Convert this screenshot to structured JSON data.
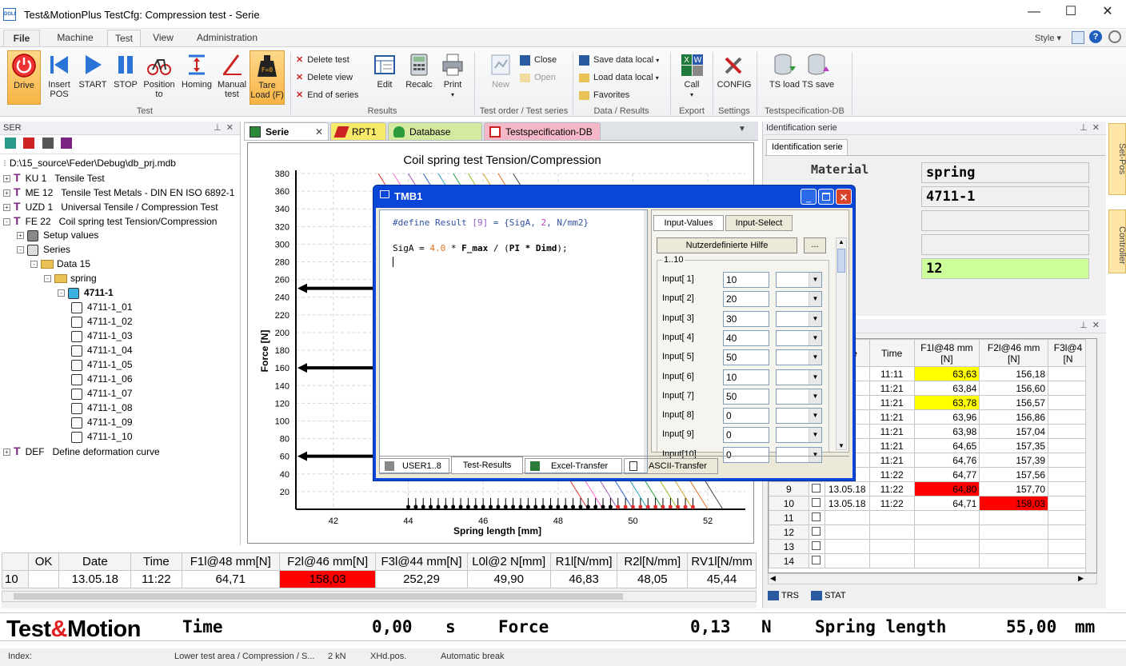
{
  "app": {
    "title": "Test&MotionPlus  TestCfg: Compression test - Serie",
    "icon_text": "DOLI"
  },
  "window_controls": {
    "minimize": "—",
    "maximize": "☐",
    "close": "✕"
  },
  "menu_tabs": [
    "File",
    "Machine",
    "Test",
    "View",
    "Administration"
  ],
  "menu_active": "Test",
  "style_label": "Style",
  "ribbon": {
    "test_buttons": [
      {
        "label": "Drive",
        "icon": "power-icon"
      },
      {
        "label": "Insert POS",
        "icon": "step-back-icon"
      },
      {
        "label": "START",
        "icon": "play-icon"
      },
      {
        "label": "STOP",
        "icon": "pause-icon"
      },
      {
        "label": "Position to",
        "icon": "bicycle-icon"
      },
      {
        "label": "Homing",
        "icon": "homing-icon"
      },
      {
        "label": "Manual test",
        "icon": "manual-test-icon"
      },
      {
        "label": "Tare Load (F)",
        "icon": "tare-weight-icon"
      }
    ],
    "test_group": "Test",
    "results_small": [
      "Delete test",
      "Delete view",
      "End of series"
    ],
    "results_buttons": [
      "Edit",
      "Recalc",
      "Print"
    ],
    "results_group": "Results",
    "order_new": "New",
    "order_small": [
      "Close",
      "Open"
    ],
    "order_group": "Test order / Test series",
    "data_small": [
      "Save data local",
      "Load data local",
      "Favorites"
    ],
    "data_group": "Data / Results",
    "export_button": "Call",
    "export_group": "Export",
    "config_button": "CONFIG",
    "settings_group": "Settings",
    "ts_buttons": [
      "TS load",
      "TS save"
    ],
    "ts_group": "Testspecification-DB"
  },
  "left_pane": {
    "header": "SER",
    "path": "D:\\15_source\\Feder\\Debug\\db_prj.mdb",
    "tree": [
      {
        "level": 0,
        "toggle": "+",
        "kind": "T",
        "code": "KU 1",
        "text": "Tensile Test"
      },
      {
        "level": 0,
        "toggle": "+",
        "kind": "T",
        "code": "ME 12",
        "text": "Tensile Test Metals - DIN EN ISO 6892-1"
      },
      {
        "level": 0,
        "toggle": "+",
        "kind": "T",
        "code": "UZD 1",
        "text": "Universal Tensile / Compression Test"
      },
      {
        "level": 0,
        "toggle": "-",
        "kind": "T",
        "code": "FE 22",
        "text": "Coil spring test Tension/Compression"
      },
      {
        "level": 1,
        "toggle": "+",
        "kind": "setup",
        "code": "",
        "text": "Setup values"
      },
      {
        "level": 1,
        "toggle": "-",
        "kind": "series",
        "code": "",
        "text": "Series"
      },
      {
        "level": 2,
        "toggle": "-",
        "kind": "folder",
        "code": "",
        "text": "Data 15"
      },
      {
        "level": 3,
        "toggle": "-",
        "kind": "folder",
        "code": "",
        "text": "spring"
      },
      {
        "level": 4,
        "toggle": "-",
        "kind": "serie",
        "code": "",
        "text": "4711-1"
      },
      {
        "level": 5,
        "toggle": "",
        "kind": "spec",
        "code": "",
        "text": "4711-1_01"
      },
      {
        "level": 5,
        "toggle": "",
        "kind": "spec",
        "code": "",
        "text": "4711-1_02"
      },
      {
        "level": 5,
        "toggle": "",
        "kind": "spec",
        "code": "",
        "text": "4711-1_03"
      },
      {
        "level": 5,
        "toggle": "",
        "kind": "spec",
        "code": "",
        "text": "4711-1_04"
      },
      {
        "level": 5,
        "toggle": "",
        "kind": "spec",
        "code": "",
        "text": "4711-1_05"
      },
      {
        "level": 5,
        "toggle": "",
        "kind": "spec",
        "code": "",
        "text": "4711-1_06"
      },
      {
        "level": 5,
        "toggle": "",
        "kind": "spec",
        "code": "",
        "text": "4711-1_07"
      },
      {
        "level": 5,
        "toggle": "",
        "kind": "spec",
        "code": "",
        "text": "4711-1_08"
      },
      {
        "level": 5,
        "toggle": "",
        "kind": "spec",
        "code": "",
        "text": "4711-1_09"
      },
      {
        "level": 5,
        "toggle": "",
        "kind": "spec",
        "code": "",
        "text": "4711-1_10"
      },
      {
        "level": 0,
        "toggle": "+",
        "kind": "T",
        "code": "DEF",
        "text": "Define deformation curve"
      }
    ]
  },
  "doc_tabs": [
    "Serie",
    "RPT1",
    "Database (FDB)",
    "Testspecification-DB"
  ],
  "chart_data": {
    "type": "line",
    "title": "Coil spring test Tension/Compression",
    "xlabel": "Spring length [mm]",
    "ylabel": "Force [N]",
    "xlim": [
      41,
      53
    ],
    "ylim": [
      0,
      380
    ],
    "x_ticks": [
      "42",
      "44",
      "46",
      "48",
      "50",
      "52"
    ],
    "y_ticks": [
      "20",
      "40",
      "60",
      "80",
      "100",
      "120",
      "140",
      "160",
      "180",
      "200",
      "220",
      "240",
      "260",
      "280",
      "300",
      "320",
      "340",
      "360",
      "380"
    ],
    "series_count": 10,
    "line_colors": [
      "#e03030",
      "#ff66cc",
      "#9b59b6",
      "#3060d0",
      "#20a0c0",
      "#20a040",
      "#90c020",
      "#d0a020",
      "#e07020",
      "#404040"
    ],
    "x_start": [
      43.2,
      43.6,
      44.0,
      44.4,
      44.8,
      45.2,
      45.6,
      46.0,
      46.4,
      46.8
    ],
    "force_arrows": [
      250,
      160,
      60
    ]
  },
  "dialog": {
    "title": "TMB1",
    "code_line1_prefix": "#define Result ",
    "code_line1_idx": "[9]",
    "code_line1_rest": " = {SigA, ",
    "code_line1_num": "2",
    "code_line1_end": ", N/mm2}",
    "code_line2_a": "SigA = ",
    "code_line2_num": "4.0",
    "code_line2_b": " * ",
    "code_line2_c": "F_max",
    "code_line2_d": " / (",
    "code_line2_e": "PI * Dimd",
    "code_line2_f": ");",
    "tabs": [
      "Input-Values",
      "Input-Select"
    ],
    "help_button": "Nutzerdefinierte Hilfe",
    "ellipsis_button": "...",
    "group_label": "1..10",
    "inputs": [
      {
        "label": "Input[ 1]",
        "value": "10"
      },
      {
        "label": "Input[ 2]",
        "value": "20"
      },
      {
        "label": "Input[ 3]",
        "value": "30"
      },
      {
        "label": "Input[ 4]",
        "value": "40"
      },
      {
        "label": "Input[ 5]",
        "value": "50"
      },
      {
        "label": "Input[ 6]",
        "value": "10"
      },
      {
        "label": "Input[ 7]",
        "value": "50"
      },
      {
        "label": "Input[ 8]",
        "value": "0"
      },
      {
        "label": "Input[ 9]",
        "value": "0"
      },
      {
        "label": "Input[10]",
        "value": "0"
      }
    ],
    "bottom_tabs": [
      "USER1..8",
      "Test-Results",
      "Excel-Transfer",
      "ASCII-Transfer"
    ]
  },
  "identification": {
    "header": "Identification serie",
    "tab": "Identification serie",
    "rows": [
      {
        "label": "Material",
        "value": "spring",
        "highlight": false
      },
      {
        "label": "ber",
        "value": "4711-1",
        "highlight": false
      },
      {
        "label": "ber",
        "value": "",
        "highlight": false
      },
      {
        "label": "ent",
        "value": "",
        "highlight": false
      },
      {
        "label": "o.",
        "value": "12",
        "highlight": true
      }
    ]
  },
  "side_tabs": [
    "Set-Pos",
    "Controller"
  ],
  "right_table": {
    "columns": [
      "",
      "",
      "Date",
      "Time",
      "F1l@48 mm\n[N]",
      "F2l@46 mm\n[N]",
      "F3l@4\n[N"
    ],
    "rows": [
      {
        "n": "",
        "date": "8",
        "time": "11:11",
        "f1": "63,63",
        "f2": "156,18",
        "f1c": "yellow",
        "f2c": ""
      },
      {
        "n": "",
        "date": "8",
        "time": "11:21",
        "f1": "63,84",
        "f2": "156,60",
        "f1c": "",
        "f2c": ""
      },
      {
        "n": "",
        "date": "8",
        "time": "11:21",
        "f1": "63,78",
        "f2": "156,57",
        "f1c": "yellow",
        "f2c": ""
      },
      {
        "n": "",
        "date": "8",
        "time": "11:21",
        "f1": "63,96",
        "f2": "156,86",
        "f1c": "",
        "f2c": ""
      },
      {
        "n": "",
        "date": "8",
        "time": "11:21",
        "f1": "63,98",
        "f2": "157,04",
        "f1c": "",
        "f2c": ""
      },
      {
        "n": "",
        "date": "8",
        "time": "11:21",
        "f1": "64,65",
        "f2": "157,35",
        "f1c": "",
        "f2c": ""
      },
      {
        "n": "",
        "date": "8",
        "time": "11:21",
        "f1": "64,76",
        "f2": "157,39",
        "f1c": "",
        "f2c": ""
      },
      {
        "n": "",
        "date": "8",
        "time": "11:22",
        "f1": "64,77",
        "f2": "157,56",
        "f1c": "",
        "f2c": ""
      },
      {
        "n": "9",
        "date": "13.05.18",
        "time": "11:22",
        "f1": "64,80",
        "f2": "157,70",
        "f1c": "red",
        "f2c": ""
      },
      {
        "n": "10",
        "date": "13.05.18",
        "time": "11:22",
        "f1": "64,71",
        "f2": "158,03",
        "f1c": "",
        "f2c": "red"
      },
      {
        "n": "11",
        "date": "",
        "time": "",
        "f1": "",
        "f2": "",
        "f1c": "",
        "f2c": ""
      },
      {
        "n": "12",
        "date": "",
        "time": "",
        "f1": "",
        "f2": "",
        "f1c": "",
        "f2c": ""
      },
      {
        "n": "13",
        "date": "",
        "time": "",
        "f1": "",
        "f2": "",
        "f1c": "",
        "f2c": ""
      },
      {
        "n": "14",
        "date": "",
        "time": "",
        "f1": "",
        "f2": "",
        "f1c": "",
        "f2c": ""
      }
    ],
    "bottom_tabs": [
      "TRS",
      "STAT"
    ]
  },
  "bottom_table": {
    "columns": [
      "",
      "OK",
      "Date",
      "Time",
      "F1l@48 mm[N]",
      "F2l@46 mm[N]",
      "F3l@44 mm[N]",
      "L0l@2 N[mm]",
      "R1l[N/mm]",
      "R2l[N/mm]",
      "RV1l[N/mm"
    ],
    "row": [
      "10",
      "",
      "13.05.18",
      "11:22",
      "64,71",
      "158,03",
      "252,29",
      "49,90",
      "46,83",
      "48,05",
      "45,44"
    ]
  },
  "live": {
    "brand": "Test&Motion",
    "time_label": "Time",
    "time_value": "0,00",
    "time_unit": "s",
    "force_label": "Force",
    "force_value": "0,13",
    "force_unit": "N",
    "length_label": "Spring length",
    "length_value": "55,00",
    "length_unit": "mm"
  },
  "statusbar": {
    "index": "Index:",
    "area": "Lower test area / Compression / S...",
    "cap": "2 kN",
    "xhd": "XHd.pos.",
    "brk": "Automatic break"
  },
  "colors": {
    "yellow": "#ffff00",
    "red": "#ff0000",
    "green": "#ccff99",
    "brand_red": "#e02020"
  }
}
